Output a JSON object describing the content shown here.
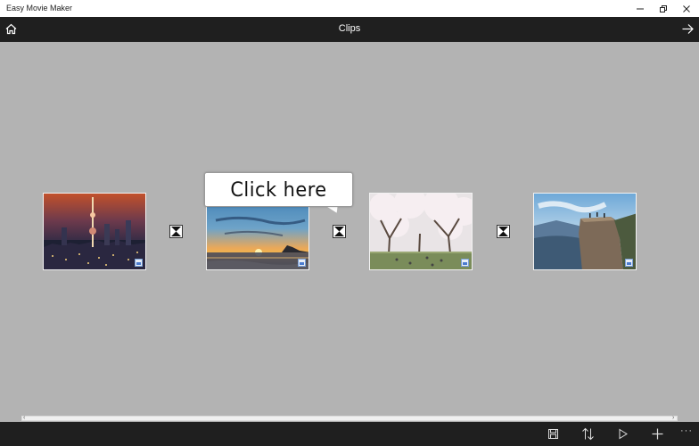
{
  "window": {
    "title": "Easy Movie Maker"
  },
  "header": {
    "title": "Clips",
    "home_icon": "home-icon",
    "next_icon": "arrow-right-icon"
  },
  "clips": [
    {
      "subject": "night city skyline with tower",
      "icon": "photo-badge-icon"
    },
    {
      "subject": "sunset over ocean",
      "icon": "photo-badge-icon"
    },
    {
      "subject": "cherry blossom park",
      "icon": "photo-badge-icon"
    },
    {
      "subject": "cliff over fjord",
      "icon": "photo-badge-icon"
    }
  ],
  "transitions": [
    "transition-icon",
    "transition-icon",
    "transition-icon"
  ],
  "callout": {
    "text": "Click here"
  },
  "commandbar": {
    "icons": [
      "save-icon",
      "sort-icon",
      "play-icon",
      "add-icon"
    ],
    "more": "···"
  },
  "colors": {
    "stage_bg": "#b3b3b3",
    "bar_bg": "#1f1f1f",
    "titlebar_bg": "#ffffff"
  }
}
